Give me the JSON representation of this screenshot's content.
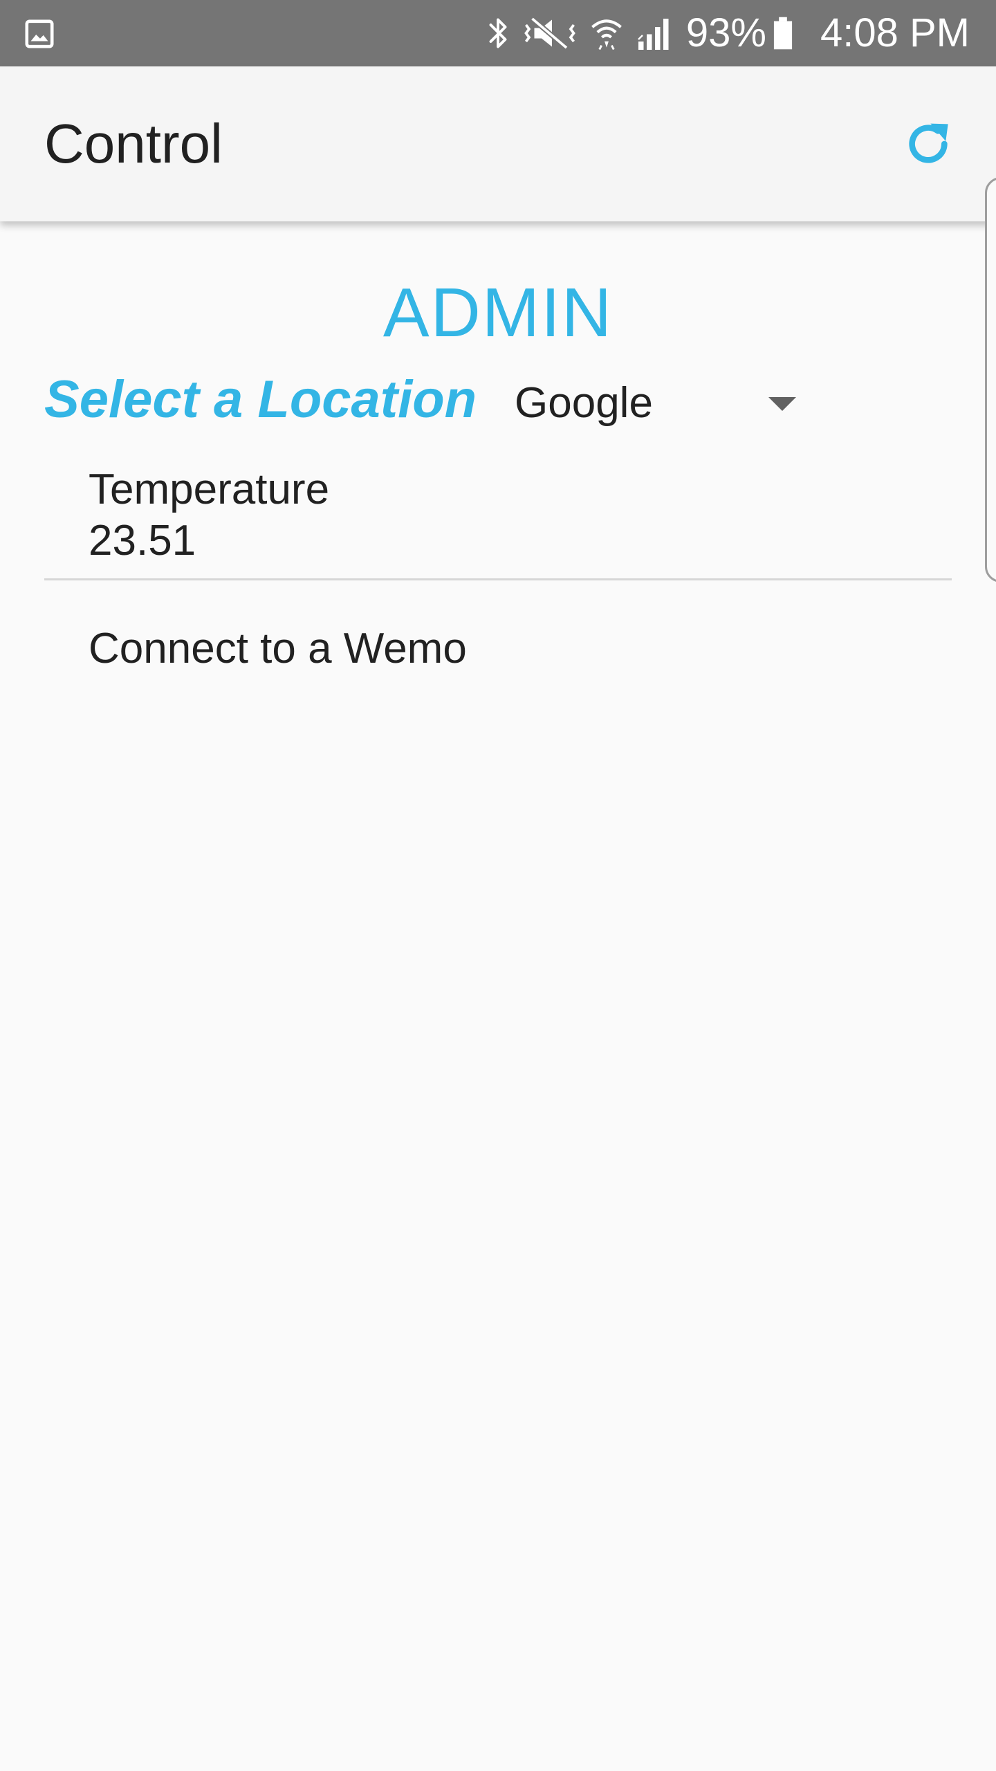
{
  "status_bar": {
    "battery_text": "93%",
    "time_text": "4:08 PM",
    "icons": [
      "gallery-icon",
      "bluetooth-icon",
      "vibrate-mute-icon",
      "wifi-icon",
      "signal-icon",
      "battery-icon"
    ]
  },
  "app_bar": {
    "title": "Control",
    "refresh_icon": "refresh-icon"
  },
  "main": {
    "heading": "ADMIN",
    "location_label": "Select a Location",
    "location_selected": "Google",
    "temperature_label": "Temperature",
    "temperature_value": "23.51",
    "wemo_link": "Connect to a Wemo"
  },
  "colors": {
    "accent": "#33b5e5",
    "status_bar": "#757575",
    "app_bar": "#f5f5f5",
    "background": "#fafafa"
  }
}
